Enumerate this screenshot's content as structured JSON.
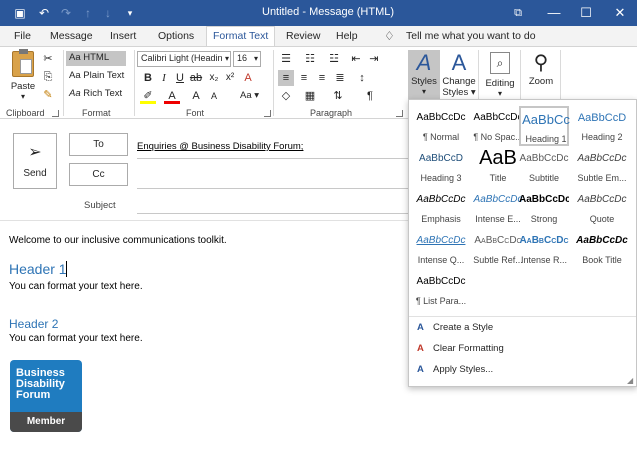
{
  "window": {
    "title": "Untitled  -  Message (HTML)",
    "quick_access": [
      "save-icon",
      "undo-icon",
      "redo-icon",
      "up-arrow-icon",
      "down-arrow-icon",
      "customize-icon"
    ],
    "controls": [
      "restore-icon",
      "minimize-icon",
      "maximize-icon",
      "close-icon"
    ]
  },
  "tabs": [
    "File",
    "Message",
    "Insert",
    "Options",
    "Format Text",
    "Review",
    "Help"
  ],
  "tell_me": "Tell me what you want to do",
  "ribbon": {
    "clipboard": {
      "label": "Clipboard",
      "paste": "Paste"
    },
    "format": {
      "label": "Format",
      "html": "HTML",
      "plain": "Plain Text",
      "rich": "Rich Text",
      "prefix": "Aa"
    },
    "font": {
      "label": "Font",
      "name": "Calibri Light (Headin",
      "size": "16",
      "aa": "Aa"
    },
    "paragraph": {
      "label": "Paragraph"
    },
    "styles": {
      "label": "Styles",
      "change_line1": "Change",
      "change_line2": "Styles"
    },
    "editing": {
      "label": "Editing"
    },
    "zoom": {
      "label": "Zoom"
    }
  },
  "compose": {
    "send": "Send",
    "to": "To",
    "cc": "Cc",
    "subject_label": "Subject",
    "to_value": "Enquiries @ Business Disability Forum;"
  },
  "body": {
    "intro": "Welcome to our inclusive communications toolkit.",
    "header1": "Header 1",
    "text1": "You can format your text here.",
    "header2": "Header 2",
    "text2": "You can format your text here."
  },
  "logo": {
    "line1": "Business",
    "line2": "Disability",
    "line3": "Forum",
    "member": "Member"
  },
  "gallery": {
    "styles": [
      {
        "preview": "AaBbCcDc",
        "name": "¶ Normal"
      },
      {
        "preview": "AaBbCcDc",
        "name": "¶ No Spac..."
      },
      {
        "preview": "AaBbCc",
        "name": "Heading 1"
      },
      {
        "preview": "AaBbCcD",
        "name": "Heading 2"
      },
      {
        "preview": "AaBbCcD",
        "name": "Heading 3"
      },
      {
        "preview": "AaB",
        "name": "Title"
      },
      {
        "preview": "AaBbCcDc",
        "name": "Subtitle"
      },
      {
        "preview": "AaBbCcDc",
        "name": "Subtle Em..."
      },
      {
        "preview": "AaBbCcDc",
        "name": "Emphasis"
      },
      {
        "preview": "AaBbCcDc",
        "name": "Intense E..."
      },
      {
        "preview": "AaBbCcDc",
        "name": "Strong"
      },
      {
        "preview": "AaBbCcDc",
        "name": "Quote"
      },
      {
        "preview": "AaBbCcDc",
        "name": "Intense Q..."
      },
      {
        "preview": "AaBbCcDc",
        "name": "Subtle Ref..."
      },
      {
        "preview": "AaBbCcDc",
        "name": "Intense R..."
      },
      {
        "preview": "AaBbCcDc",
        "name": "Book Title"
      },
      {
        "preview": "AaBbCcDc",
        "name": "¶ List Para..."
      }
    ],
    "actions": [
      "Create a Style",
      "Clear Formatting",
      "Apply Styles..."
    ]
  },
  "colors": {
    "accent": "#2b579a",
    "heading": "#2e74b5",
    "logo": "#1f7cc0"
  }
}
